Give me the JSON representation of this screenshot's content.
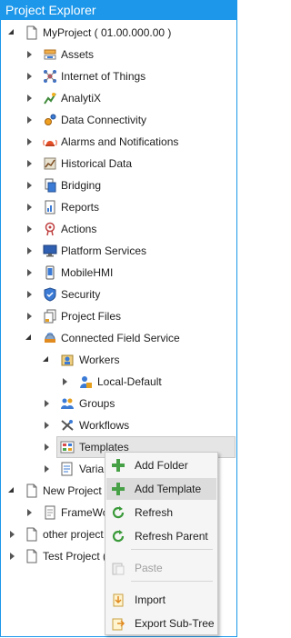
{
  "title": "Project Explorer",
  "tree": [
    {
      "key": "myproject",
      "label": "MyProject ( 01.00.000.00 )",
      "toggle": "expanded",
      "icon": "project-file-icon"
    },
    {
      "key": "assets",
      "label": "Assets",
      "toggle": "collapsed",
      "icon": "assets-icon"
    },
    {
      "key": "iot",
      "label": "Internet of Things",
      "toggle": "collapsed",
      "icon": "iot-icon"
    },
    {
      "key": "analytix",
      "label": "AnalytiX",
      "toggle": "collapsed",
      "icon": "analytix-icon"
    },
    {
      "key": "data-connectivity",
      "label": "Data Connectivity",
      "toggle": "collapsed",
      "icon": "gears-icon"
    },
    {
      "key": "alarms",
      "label": "Alarms and Notifications",
      "toggle": "collapsed",
      "icon": "alarm-icon"
    },
    {
      "key": "historical",
      "label": "Historical Data",
      "toggle": "collapsed",
      "icon": "historical-icon"
    },
    {
      "key": "bridging",
      "label": "Bridging",
      "toggle": "collapsed",
      "icon": "bridging-icon"
    },
    {
      "key": "reports",
      "label": "Reports",
      "toggle": "collapsed",
      "icon": "reports-icon"
    },
    {
      "key": "actions",
      "label": "Actions",
      "toggle": "collapsed",
      "icon": "actions-icon"
    },
    {
      "key": "platform",
      "label": "Platform Services",
      "toggle": "collapsed",
      "icon": "monitor-icon"
    },
    {
      "key": "mobilehmi",
      "label": "MobileHMI",
      "toggle": "collapsed",
      "icon": "mobile-icon"
    },
    {
      "key": "security",
      "label": "Security",
      "toggle": "collapsed",
      "icon": "shield-icon"
    },
    {
      "key": "project-files",
      "label": "Project Files",
      "toggle": "collapsed",
      "icon": "files-icon"
    },
    {
      "key": "cfs",
      "label": "Connected Field Service",
      "toggle": "expanded",
      "icon": "field-service-icon"
    },
    {
      "key": "workers",
      "label": "Workers",
      "toggle": "expanded",
      "icon": "workers-icon"
    },
    {
      "key": "local-default",
      "label": "Local-Default",
      "toggle": "collapsed",
      "icon": "worker-icon"
    },
    {
      "key": "groups",
      "label": "Groups",
      "toggle": "collapsed",
      "icon": "groups-icon"
    },
    {
      "key": "workflows",
      "label": "Workflows",
      "toggle": "collapsed",
      "icon": "workflows-icon"
    },
    {
      "key": "templates",
      "label": "Templates",
      "toggle": "collapsed",
      "icon": "templates-icon"
    },
    {
      "key": "variables",
      "label": "Varia",
      "toggle": "collapsed",
      "icon": "variables-icon"
    },
    {
      "key": "new-project",
      "label": "New Project",
      "toggle": "expanded",
      "icon": "project-file-icon"
    },
    {
      "key": "framework",
      "label": "FrameWo",
      "toggle": "collapsed",
      "icon": "document-icon"
    },
    {
      "key": "other-project",
      "label": "other project",
      "toggle": "collapsed",
      "icon": "project-file-icon"
    },
    {
      "key": "test-project",
      "label": "Test Project (",
      "toggle": "collapsed",
      "icon": "project-file-icon"
    }
  ],
  "context_menu": {
    "items": [
      {
        "key": "add-folder",
        "label": "Add Folder",
        "icon": "plus-icon",
        "state": "normal"
      },
      {
        "key": "add-template",
        "label": "Add Template",
        "icon": "plus-icon",
        "state": "highlighted"
      },
      {
        "key": "refresh",
        "label": "Refresh",
        "icon": "refresh-icon",
        "state": "normal"
      },
      {
        "key": "refresh-parent",
        "label": "Refresh Parent",
        "icon": "refresh-icon",
        "state": "normal"
      },
      {
        "key": "paste",
        "label": "Paste",
        "icon": "paste-icon",
        "state": "disabled"
      },
      {
        "key": "import",
        "label": "Import",
        "icon": "import-icon",
        "state": "normal"
      },
      {
        "key": "export-sub-tree",
        "label": "Export Sub-Tree",
        "icon": "export-icon",
        "state": "normal"
      }
    ]
  },
  "colors": {
    "accent": "#1c97ea",
    "selection": "#e5e5e5",
    "menu_highlight": "#dcdcdc"
  }
}
